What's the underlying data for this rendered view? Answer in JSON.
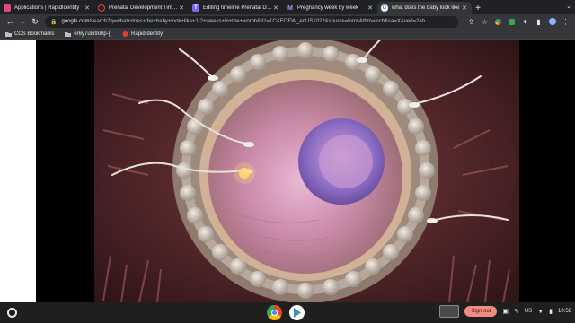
{
  "tabs": [
    {
      "title": "Applications | RapidIdentity",
      "favicon_color": "#e8457c",
      "active": false
    },
    {
      "title": "Prenatal Development Timeline",
      "favicon_color": "#ea4335",
      "active": false
    },
    {
      "title": "Editing timeline Prenatal Devel",
      "favicon_color": "#7b61ff",
      "active": false
    },
    {
      "title": "Pregnancy week by week",
      "favicon_color": "#8e44ad",
      "active": false
    },
    {
      "title": "what does the baby look like",
      "favicon_color": "#4285f4",
      "active": true
    }
  ],
  "omnibox": {
    "host": "google.com",
    "path": "/search?q=what+does+the+baby+look+like+1-2+weeks+in+the+womb&rlz=1CAEOEW_enUS1022&source=lnms&tbm=isch&sa=X&ved=2ah..."
  },
  "bookmarks": [
    {
      "label": "CCS Bookmarks",
      "icon": "folder-icon"
    },
    {
      "label": "er6y7u8i9o0p-[]",
      "icon": "folder-icon"
    },
    {
      "label": "RapidIdentity",
      "icon": "rapididentity-icon"
    }
  ],
  "shelf": {
    "signout_label": "Sign out",
    "region": "US",
    "time": "10:58"
  },
  "colors": {
    "tabstrip": "#202124",
    "toolbar": "#35363a",
    "signout": "#f28b82"
  }
}
